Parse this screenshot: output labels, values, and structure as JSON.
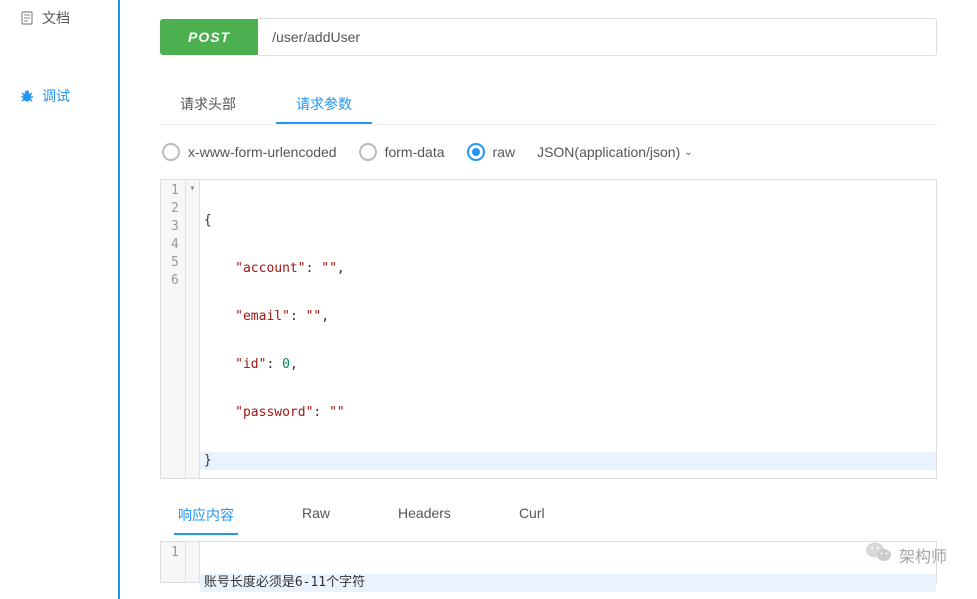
{
  "sidebar": {
    "items": [
      {
        "label": "文档",
        "icon": "doc-icon",
        "active": false
      },
      {
        "label": "调试",
        "icon": "bug-icon",
        "active": true
      }
    ]
  },
  "request": {
    "method": "POST",
    "url": "/user/addUser"
  },
  "requestTabs": [
    {
      "label": "请求头部",
      "active": false
    },
    {
      "label": "请求参数",
      "active": true
    }
  ],
  "bodyTypes": [
    {
      "label": "x-www-form-urlencoded",
      "checked": false
    },
    {
      "label": "form-data",
      "checked": false
    },
    {
      "label": "raw",
      "checked": true
    }
  ],
  "contentType": "JSON(application/json)",
  "editorLines": {
    "l1": "{",
    "l2_key": "\"account\"",
    "l2_sep": ": ",
    "l2_val": "\"\"",
    "l2_tail": ",",
    "l3_key": "\"email\"",
    "l3_sep": ": ",
    "l3_val": "\"\"",
    "l3_tail": ",",
    "l4_key": "\"id\"",
    "l4_sep": ": ",
    "l4_val": "0",
    "l4_tail": ",",
    "l5_key": "\"password\"",
    "l5_sep": ": ",
    "l5_val": "\"\"",
    "l5_tail": "",
    "l6": "}"
  },
  "lineNumbers": {
    "n1": "1",
    "n2": "2",
    "n3": "3",
    "n4": "4",
    "n5": "5",
    "n6": "6"
  },
  "responseTabs": [
    {
      "label": "响应内容",
      "active": true
    },
    {
      "label": "Raw",
      "active": false
    },
    {
      "label": "Headers",
      "active": false
    },
    {
      "label": "Curl",
      "active": false
    }
  ],
  "responseLineNo": "1",
  "responseBody": "账号长度必须是6-11个字符",
  "watermark": "架构师"
}
